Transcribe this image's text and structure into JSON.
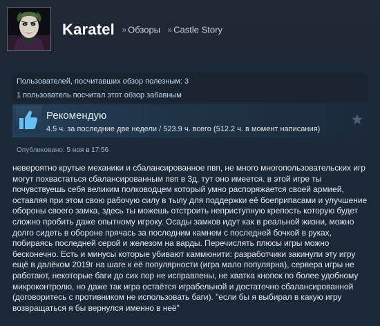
{
  "header": {
    "username": "Karatel",
    "breadcrumbs": [
      {
        "label": "Обзоры"
      },
      {
        "label": "Castle Story"
      }
    ],
    "separator": "»"
  },
  "helpful_box": {
    "line1": "Пользователей, посчитавших обзор полезным: 3",
    "line2": "1 пользователь посчитал этот обзор забавным"
  },
  "verdict": {
    "title": "Рекомендую",
    "hours": "4.5 ч. за последние две недели / 523.9 ч. всего (512.2 ч. в момент написания)",
    "icon": "thumbs-up-icon",
    "star_icon": "star-icon"
  },
  "posted": {
    "label": "Опубликовано:",
    "date": "5 ноя в 17:56"
  },
  "review": {
    "text": "невероятно крутые механики и сбалансированное пвп, не много многопользовательских игр могут похвастаться сбалансированным пвп в 3д, тут оно имеется. в этой игре ты почувствуешь себя великим полководцем который умно распоряжается своей армией, оставляя при этом свою рабочую силу в тылу для поддержки её боеприпасами и улучшение обороны своего замка, здесь ты можешь отстроить неприступную крепость которую будет сложно пробить даже опытному игроку. Осады замков идут как в реальной жизни, можно долго сидеть в обороне прячась за последним камнем с последней бочкой в руках, побираясь последней серой и железом на варды. Перечислять плюсы игры можно бесконечно. Есть и минусы которые убивают каммюнити: разработчики закинули эту игру ещё в далёком 2019г на шаге к её популярности (игра мало популярна), сервера игры не работают, некоторые баги до сих пор не исправлены, не хватка кнопок по более удобному микроконтролю, но даже так игра остаётся играбельной и достаточно сбалансированной (договоритесь с противником не использовать баги). \"если бы я выбирал в какую игру возвращаться я бы вернулся именно в неё\""
  },
  "colors": {
    "background": "#1b2838",
    "verdict_gradient_start": "#243f58",
    "thumb_blue": "#66c0f4"
  }
}
